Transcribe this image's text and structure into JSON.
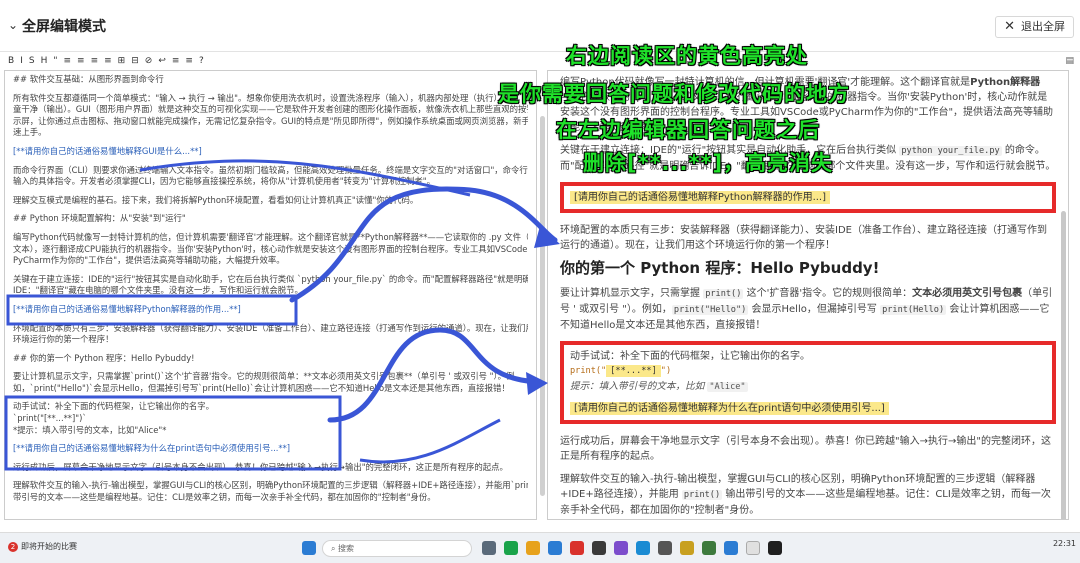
{
  "window": {
    "expand_icon": "chevron-down-icon",
    "title": "全屏编辑模式",
    "exit_label": "退出全屏"
  },
  "toolbar": {
    "buttons": [
      "B",
      "I",
      "S",
      "H",
      "\"",
      "≡",
      "≡",
      "≡",
      "≡",
      "⊞",
      "⊟",
      "⊘",
      "↩",
      "≡",
      "≡",
      "?"
    ],
    "more": "▤"
  },
  "editor": {
    "lines": [
      "## 软件交互基础：从图形界面到命令行",
      "",
      "所有软件交互都遵循同一个简单模式：\"输入 → 执行 → 输出\"。想象你使用洗衣机时，设置洗涤程序（输入），机器内部处理（执行），",
      "童干净（输出）。GUI（图形用户界面）就是这种交互的可视化实现——它是软件开发者创建的图形化操作面板，就像洗衣机上那些直观的按钮",
      "示屏，让你通过点击图标、拖动窗口就能完成操作，无需记忆复杂指令。GUI的特点是\"所见即所得\"，例如操作系统桌面或网页浏览器，新手也能快",
      "速上手。",
      "",
      "[**请用你自己的话通俗易懂地解释GUI是什么...**]",
      "",
      "而命令行界面（CLI）则要求你通过终端输入文本指令。虽然初期门槛较高，但能高效处理批量任务。终端是文字交互的\"对话窗口\"，命令行则是你",
      "输入的具体指令。开发者必须掌握CLI，因为它能够直接操控系统，将你从\"计算机使用者\"转变为\"计算机控制者\"。",
      "",
      "理解交互模式是编程的基石。接下来，我们将拆解Python环境配置，看看如何让计算机真正\"读懂\"你的代码。",
      "",
      "## Python 环境配置解构：从\"安装\"到\"运行\"",
      "",
      "编写Python代码就像写一封特计算机的信，但计算机需要'翻译官'才能理解。这个翻译官就是**Python解释器**——它读取你的 .py 文件（纯",
      "文本），逐行翻译成CPU能执行的机器指令。当你'安装Python'时，核心动作就是安装这个没有图形界面的控制台程序。专业工具如VSCode或",
      "PyCharm作为你的\"工作台\"，提供语法高亮等辅助功能，大幅提升效率。",
      "",
      "关键在于建立连接：IDE的\"运行\"按钮其实是自动化助手，它在后台执行类似 `python your_file.py` 的命令。而\"配置解释器路径\"就是明确告诉",
      "IDE：\"翻译官\"藏在电脑的哪个文件夹里。没有这一步，写作和运行就会脱节。",
      "",
      "[**请用你自己的话通俗易懂地解释Python解释器的作用...**]",
      "",
      "环境配置的本质只有三步：安装解释器（获得翻译能力）、安装IDE（准备工作台）、建立路径连接（打通写作到运行的通道）。现在，让我们用这个",
      "环境运行你的第一个程序！",
      "",
      "## 你的第一个 Python 程序：Hello Pybuddy!",
      "",
      "要让计算机显示文字，只需掌握`print()`这个'扩音器'指令。它的规则很简单：**文本必须用英文引号包裹**（单引号 ' 或双引号 \"）。例",
      "如，`print(\"Hello\")`会显示Hello，但漏掉引号写`print(Hello)`会让计算机困惑——它不知道Hello是文本还是其他东西，直接报错！",
      "",
      "动手试试：补全下面的代码框架，让它输出你的名字。",
      "`print(\"[**...**]\")`",
      "*提示：填入带引号的文本，比如\"Alice\"*",
      "",
      "[**请用你自己的话通俗易懂地解释为什么在print语句中必须使用引号...**]",
      "",
      "运行成功后，屏幕会干净地显示文字（引号本身不会出现）。恭喜！你已跨越\"输入→执行→输出\"的完整闭环，这正是所有程序的起点。",
      "",
      "理解软件交互的输入-执行-输出模型，掌握GUI与CLI的核心区别，明确Python环境配置的三步逻辑（解释器+IDE+路径连接），并能用`print()`输出",
      "带引号的文本——这些是编程地基。记住：CLI是效率之钥，而每一次亲手补全代码，都在加固你的\"控制者\"身份。"
    ]
  },
  "preview": {
    "p1_pre": "编写Python代码就像写一封特计算机的信，但计算机需要'翻译官'才能理解。这个翻译官就是",
    "p1_bold": "Python解释器",
    "p1_mid": "——它读取你的 .py 文件（纯文本），逐行翻译成CPU能执行的机器指令。当你'安装Python'时，核心动作就是安装这个没有图形界面的控制台程序。专业工具如VSCode或PyCharm作为你的\"工作台\"，提供语法高亮等辅助功能，大幅提升效率。",
    "p2_pre": "关键在于建立连接：IDE的\"运行\"按钮其实是自动化助手，它在后台执行类似",
    "p2_code": "python your_file.py",
    "p2_post": "的命令。而\"配置解释器路径\"就是明确告诉IDE：\"翻译官\"藏在电脑的哪个文件夹里。没有这一步，写作和运行就会脱节。",
    "q1": "[请用你自己的话通俗易懂地解释Python解释器的作用...]",
    "p3": "环境配置的本质只有三步：安装解释器（获得翻译能力）、安装IDE（准备工作台）、建立路径连接（打通写作到运行的通道）。现在，让我们用这个环境运行你的第一个程序！",
    "h2": "你的第一个 Python 程序：Hello Pybuddy!",
    "p4_pre": "要让计算机显示文字，只需掌握",
    "p4_code1": "print()",
    "p4_mid": "这个'扩音器'指令。它的规则很简单：",
    "p4_bold": "文本必须用英文引号包裹",
    "p4_mid2": "（单引号 ' 或双引号 \"）。例如，",
    "p4_code2": "print(\"Hello\")",
    "p4_mid3": "会显示Hello，但漏掉引号写",
    "p4_code3": "print(Hello)",
    "p4_post": "会让计算机困惑——它不知道Hello是文本还是其他东西，直接报错！",
    "try_label": "动手试试：补全下面的代码框架，让它输出你的名字。",
    "code_pre": "print(\"",
    "code_blank": "[**...**]",
    "code_post": "\")",
    "hint_pre": "提示：填入带引号的文本，比如",
    "hint_code": "\"Alice\"",
    "q2": "[请用你自己的话通俗易懂地解释为什么在print语句中必须使用引号...]",
    "p5": "运行成功后，屏幕会干净地显示文字（引号本身不会出现）。恭喜！你已跨越\"输入→执行→输出\"的完整闭环，这正是所有程序的起点。",
    "p6_pre": "理解软件交互的输入-执行-输出模型，掌握GUI与CLI的核心区别，明确Python环境配置的三步逻辑（解释器+IDE+路径连接），并能用",
    "p6_code": "print()",
    "p6_post": "输出带引号的文本——这些是编程地基。记住：CLI是效率之钥，而每一次亲手补全代码，都在加固你的\"控制者\"身份。"
  },
  "annotation": {
    "line1": "右边阅读区的黄色高亮处",
    "line2": "是你需要回答问题和修改代码的地方",
    "line3": "在左边编辑器回答问题之后",
    "line4": "删除[**...**]，高亮消失"
  },
  "taskbar": {
    "notification_count": "2",
    "notification_text": "即将开始的比赛",
    "search_placeholder": "搜索",
    "time": "22:31"
  },
  "colors": {
    "annotation_green": "#1fe22a",
    "highlight_yellow": "#fbe88a",
    "red_box": "#e62a2a",
    "blue_box": "#3a56d6"
  }
}
